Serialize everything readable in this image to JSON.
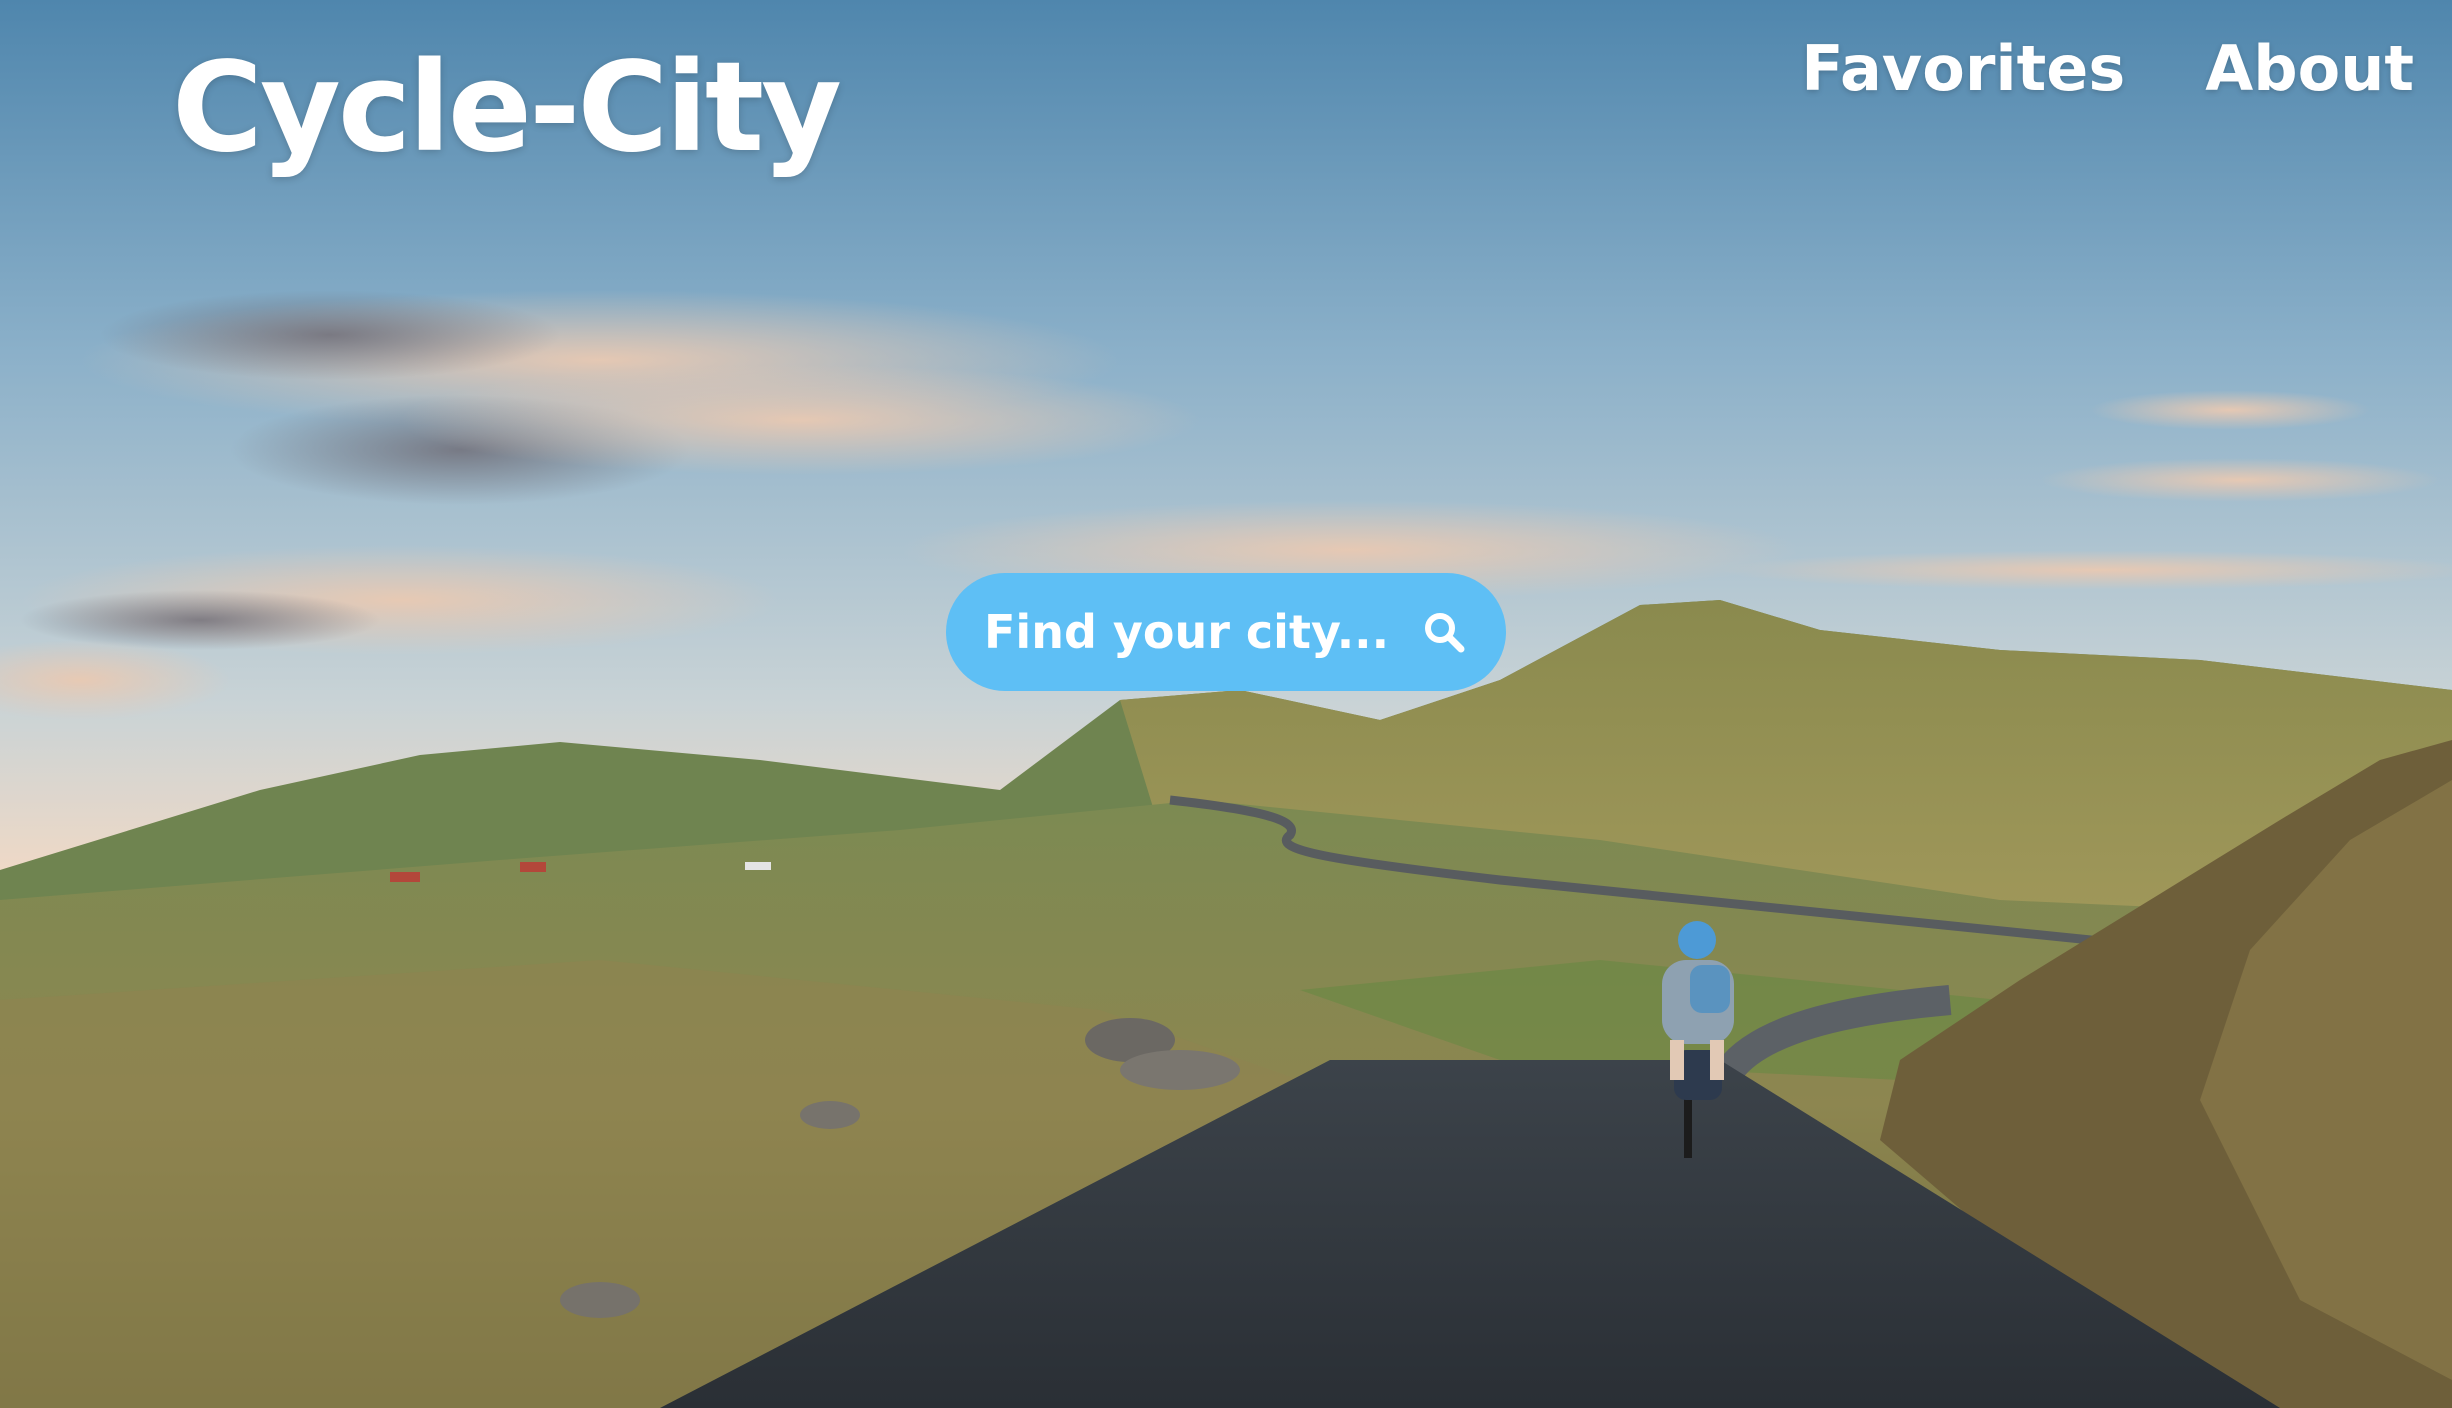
{
  "brand": {
    "name": "Cycle-City"
  },
  "nav": {
    "favorites": "Favorites",
    "about": "About"
  },
  "search": {
    "placeholder": "Find your city...",
    "value": "",
    "icon": "search-icon"
  },
  "background": {
    "subject": "landscape-photo-cyclist-road"
  },
  "colors": {
    "search_bg": "#5ebff5",
    "text": "#ffffff"
  }
}
